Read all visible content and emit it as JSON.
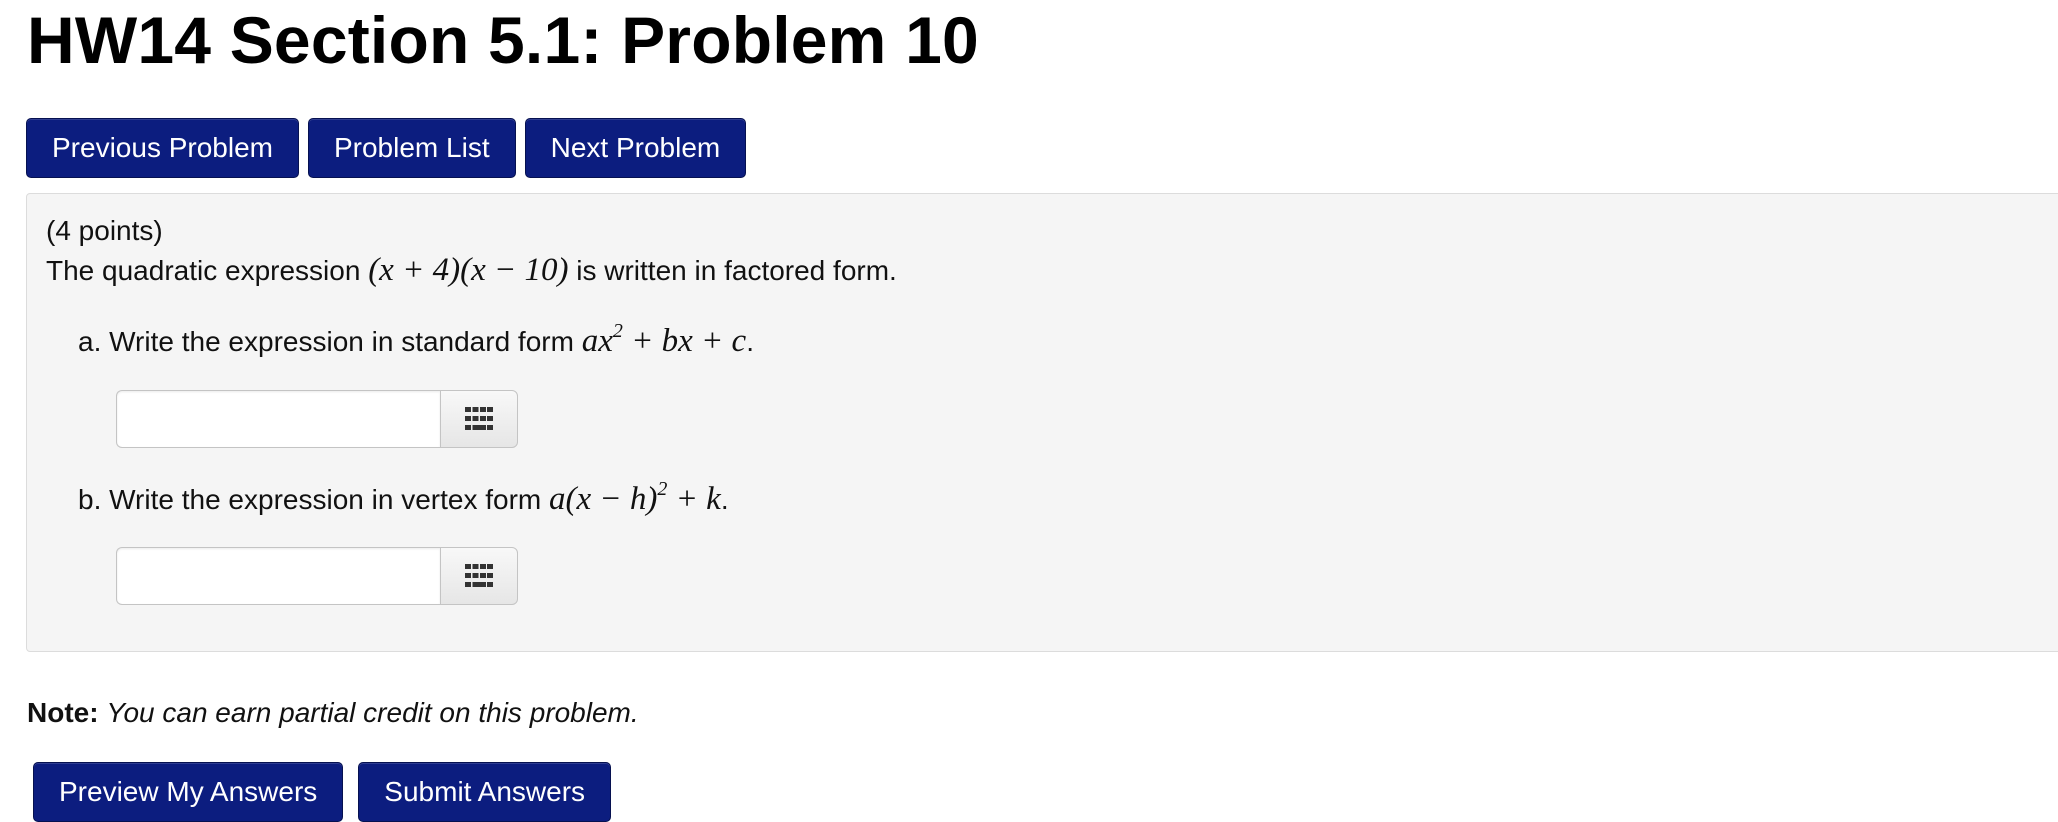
{
  "page": {
    "title": "HW14 Section 5.1: Problem 10"
  },
  "nav": {
    "previous_label": "Previous Problem",
    "list_label": "Problem List",
    "next_label": "Next Problem"
  },
  "problem": {
    "points": "(4 points)",
    "intro_prefix": "The quadratic expression",
    "intro_expr": "(x + 4)(x − 10)",
    "intro_suffix": "is written in factored form.",
    "part_a_text": "a. Write the expression in standard form",
    "part_a_expr_base": "ax",
    "part_a_expr_exp": "2",
    "part_a_expr_tail": " + bx + c",
    "part_a_period": ".",
    "part_a_value": "",
    "part_b_text": "b. Write the expression in vertex form",
    "part_b_expr_base": "a(x − h)",
    "part_b_expr_exp": "2",
    "part_b_expr_tail": " + k",
    "part_b_period": ".",
    "part_b_value": ""
  },
  "icons": {
    "keyboard": "keypad-grid-icon"
  },
  "note": {
    "label": "Note:",
    "text": "You can earn partial credit on this problem."
  },
  "actions": {
    "preview_label": "Preview My Answers",
    "submit_label": "Submit Answers"
  },
  "colors": {
    "button_bg": "#0c1d7f",
    "panel_bg": "#f5f5f5"
  }
}
